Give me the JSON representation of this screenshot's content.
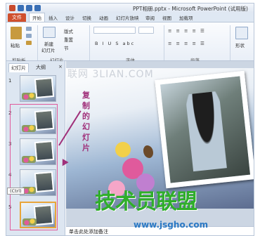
{
  "window": {
    "title": "PPT相册.pptx - Microsoft PowerPoint (试用版)"
  },
  "ribbon_tabs": [
    {
      "label": "文件"
    },
    {
      "label": "开始"
    },
    {
      "label": "插入"
    },
    {
      "label": "设计"
    },
    {
      "label": "切换"
    },
    {
      "label": "动画"
    },
    {
      "label": "幻灯片放映"
    },
    {
      "label": "审阅"
    },
    {
      "label": "视图"
    },
    {
      "label": "加载项"
    }
  ],
  "ribbon": {
    "paste": "粘贴",
    "new_slide": "新建",
    "new_slide_2": "幻灯片",
    "layout": "版式",
    "reset": "重置",
    "section": "节",
    "group_clipboard": "剪贴板",
    "group_slides": "幻灯片",
    "group_font": "字体",
    "group_paragraph": "段落",
    "shape": "形状",
    "font_buttons": "B I U S abc",
    "paragraph_buttons": "≡ ≡ ≡ ≡ ☰"
  },
  "left_pane": {
    "tab_slides": "幻灯片",
    "tab_outline": "大纲",
    "close": "×",
    "slides": [
      {
        "num": "1"
      },
      {
        "num": "2"
      },
      {
        "num": "3"
      },
      {
        "num": "4"
      },
      {
        "num": "5"
      }
    ],
    "paste_badge": "(Ctrl)"
  },
  "annotation": {
    "text": "复制的幻灯片"
  },
  "watermarks": {
    "top": "联网 3LIAN.COM",
    "main": "技术员联盟",
    "url": "www.jsgho.com"
  },
  "notes": {
    "placeholder": "单击此处添加备注"
  },
  "colors": {
    "file_tab": "#d0502d",
    "annotation": "#a0307a",
    "watermark_green": "#2fae2a",
    "watermark_blue": "#2b79c4"
  }
}
